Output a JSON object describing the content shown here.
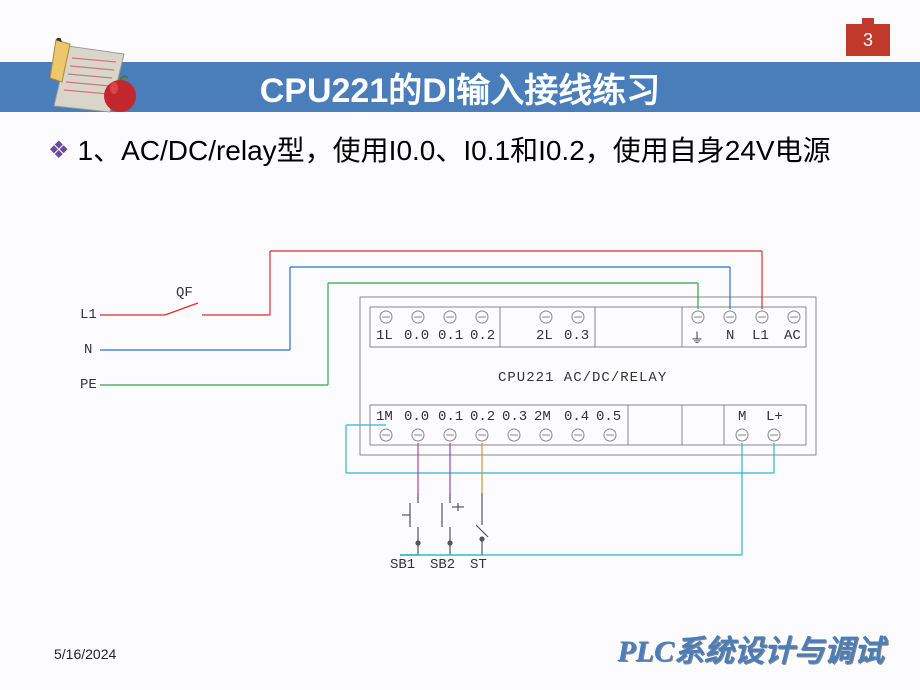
{
  "page_number": "3",
  "title": "CPU221的DI输入接线练习",
  "bullet": "1、AC/DC/relay型，使用I0.0、I0.1和I0.2，使用自身24V电源",
  "footer_date": "5/16/2024",
  "footer_brand": "PLC系统设计与调试",
  "diagram": {
    "switch_label": "QF",
    "supply_lines": [
      "L1",
      "N",
      "PE"
    ],
    "module_label": "CPU221 AC/DC/RELAY",
    "top_terminals": [
      "1L",
      "0.0",
      "0.1",
      "0.2",
      "",
      "2L",
      "0.3",
      "",
      "",
      "⏚",
      "N",
      "L1",
      "AC"
    ],
    "bottom_terminals": [
      "1M",
      "0.0",
      "0.1",
      "0.2",
      "0.3",
      "2M",
      "0.4",
      "0.5",
      "",
      "",
      "",
      "M",
      "L+"
    ],
    "input_devices": [
      "SB1",
      "SB2",
      "ST"
    ]
  }
}
